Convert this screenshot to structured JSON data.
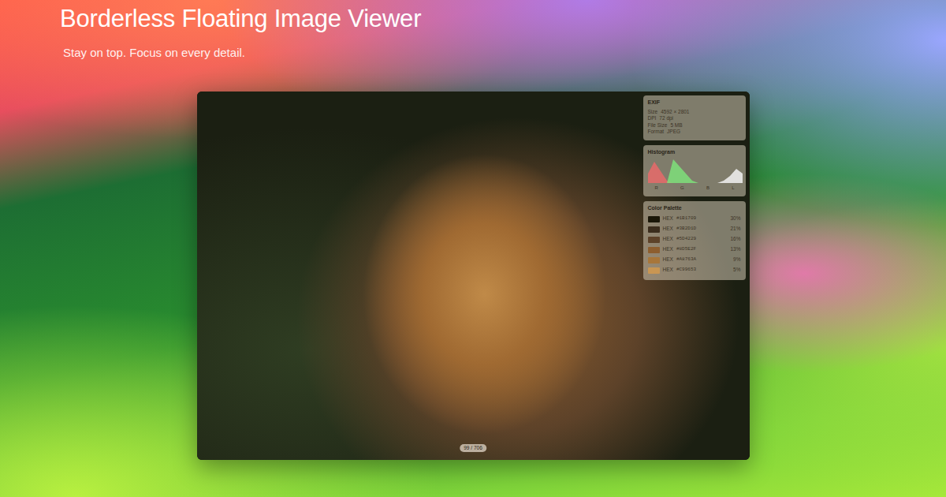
{
  "page": {
    "title": "Borderless Floating Image Viewer",
    "subtitle": "Stay on top. Focus on every detail."
  },
  "viewer": {
    "counter": "99 / 706"
  },
  "exif": {
    "title": "EXIF",
    "rows": [
      {
        "label": "Size",
        "value": "4592 × 2801"
      },
      {
        "label": "DPI",
        "value": "72 dpi"
      },
      {
        "label": "File Size",
        "value": "5 MB"
      },
      {
        "label": "Format",
        "value": "JPEG"
      }
    ]
  },
  "histogram": {
    "title": "Histogram",
    "series": [
      {
        "name": "red",
        "color": "#e86a6a",
        "values": [
          4,
          9,
          5,
          1,
          0,
          0,
          0,
          0,
          0,
          0,
          0,
          0,
          0,
          0,
          0,
          0
        ]
      },
      {
        "name": "green",
        "color": "#7ee07a",
        "values": [
          0,
          0,
          0,
          0,
          10,
          7,
          4,
          1,
          0,
          0,
          0,
          0,
          0,
          0,
          0,
          0
        ]
      },
      {
        "name": "luma",
        "color": "#f2f2f2",
        "values": [
          0,
          0,
          0,
          0,
          0,
          0,
          0,
          0,
          0,
          0,
          0,
          0,
          1,
          3,
          6,
          4
        ]
      }
    ],
    "ticks": [
      "R",
      "G",
      "B",
      "L"
    ]
  },
  "palette": {
    "title": "Color Palette",
    "swatches": [
      {
        "label": "HEX",
        "hex": "#1B1709",
        "share": "30%",
        "color": "#1b1709"
      },
      {
        "label": "HEX",
        "hex": "#3B2D1D",
        "share": "21%",
        "color": "#3b2d1d"
      },
      {
        "label": "HEX",
        "hex": "#5D4229",
        "share": "16%",
        "color": "#5d4229"
      },
      {
        "label": "HEX",
        "hex": "#8D5E2F",
        "share": "13%",
        "color": "#8d5e2f"
      },
      {
        "label": "HEX",
        "hex": "#A8763A",
        "share": "9%",
        "color": "#a8763a"
      },
      {
        "label": "HEX",
        "hex": "#C99653",
        "share": "5%",
        "color": "#c99653"
      }
    ]
  }
}
